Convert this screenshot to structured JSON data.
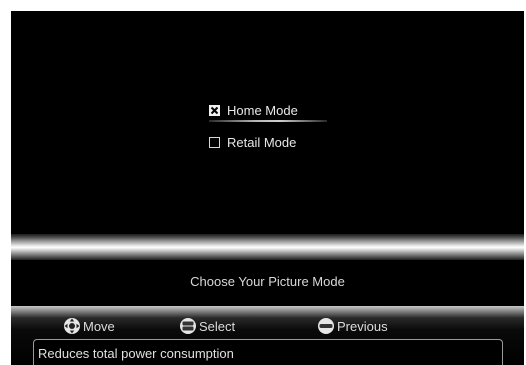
{
  "options": {
    "home_mode": {
      "label": "Home Mode",
      "checked": true
    },
    "retail_mode": {
      "label": "Retail Mode",
      "checked": false
    }
  },
  "title": "Choose Your Picture Mode",
  "help_bar": {
    "move": {
      "label": "Move",
      "icon": "dpad-icon"
    },
    "select": {
      "label": "Select",
      "icon": "ok-enter-icon"
    },
    "previous": {
      "label": "Previous",
      "icon": "menu-icon"
    }
  },
  "description": "Reduces total power consumption",
  "colors": {
    "background": "#000000",
    "text": "#e0e0e0",
    "frame": "#ffffff"
  }
}
